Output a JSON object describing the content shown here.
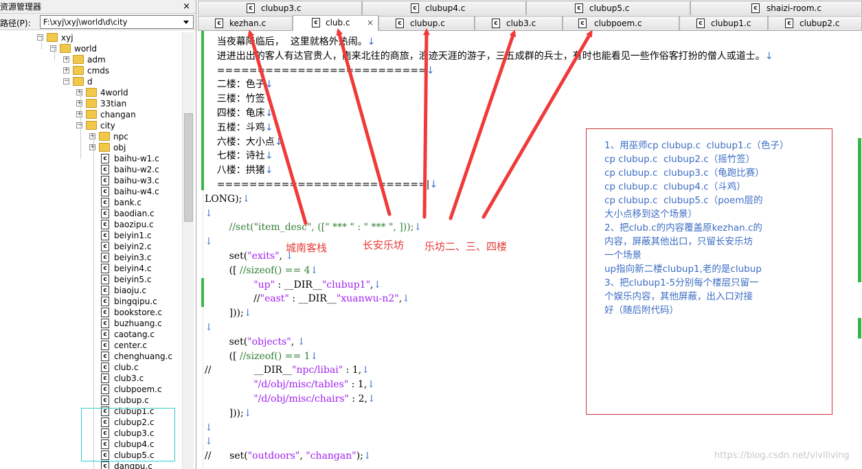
{
  "explorer": {
    "title": "资源管理器",
    "close": "×",
    "path_label": "路径(P):",
    "path_value": "F:\\xyj\\xyj\\world\\d\\city",
    "tree": [
      {
        "text": "xyj",
        "kind": "folder",
        "exp": "⊟"
      },
      {
        "text": "world",
        "kind": "folder",
        "exp": "⊟"
      },
      {
        "text": "adm",
        "kind": "folder",
        "exp": "⊞"
      },
      {
        "text": "cmds",
        "kind": "folder",
        "exp": "⊞"
      },
      {
        "text": "d",
        "kind": "folder",
        "exp": "⊟"
      },
      {
        "text": "4world",
        "kind": "folder",
        "exp": "⊞"
      },
      {
        "text": "33tian",
        "kind": "folder",
        "exp": "⊞"
      },
      {
        "text": "changan",
        "kind": "folder",
        "exp": "⊞"
      },
      {
        "text": "city",
        "kind": "folder",
        "exp": "⊟"
      },
      {
        "text": "npc",
        "kind": "folder",
        "exp": "⊞"
      },
      {
        "text": "obj",
        "kind": "folder",
        "exp": "⊞"
      },
      {
        "text": "baihu-w1.c",
        "kind": "file"
      },
      {
        "text": "baihu-w2.c",
        "kind": "file"
      },
      {
        "text": "baihu-w3.c",
        "kind": "file"
      },
      {
        "text": "baihu-w4.c",
        "kind": "file"
      },
      {
        "text": "bank.c",
        "kind": "file"
      },
      {
        "text": "baodian.c",
        "kind": "file"
      },
      {
        "text": "baozipu.c",
        "kind": "file"
      },
      {
        "text": "beiyin1.c",
        "kind": "file"
      },
      {
        "text": "beiyin2.c",
        "kind": "file"
      },
      {
        "text": "beiyin3.c",
        "kind": "file"
      },
      {
        "text": "beiyin4.c",
        "kind": "file"
      },
      {
        "text": "beiyin5.c",
        "kind": "file"
      },
      {
        "text": "biaoju.c",
        "kind": "file"
      },
      {
        "text": "bingqipu.c",
        "kind": "file"
      },
      {
        "text": "bookstore.c",
        "kind": "file"
      },
      {
        "text": "buzhuang.c",
        "kind": "file"
      },
      {
        "text": "caotang.c",
        "kind": "file"
      },
      {
        "text": "center.c",
        "kind": "file"
      },
      {
        "text": "chenghuang.c",
        "kind": "file"
      },
      {
        "text": "club.c",
        "kind": "file"
      },
      {
        "text": "club3.c",
        "kind": "file"
      },
      {
        "text": "clubpoem.c",
        "kind": "file"
      },
      {
        "text": "clubup.c",
        "kind": "file"
      },
      {
        "text": "clubup1.c",
        "kind": "file"
      },
      {
        "text": "clubup2.c",
        "kind": "file"
      },
      {
        "text": "clubup3.c",
        "kind": "file"
      },
      {
        "text": "clubup4.c",
        "kind": "file"
      },
      {
        "text": "clubup5.c",
        "kind": "file"
      },
      {
        "text": "dangpu.c",
        "kind": "file"
      }
    ]
  },
  "tabs_top": [
    "clubup3.c",
    "clubup4.c",
    "clubup5.c",
    "shaizi-room.c"
  ],
  "tabs_bottom": [
    "kezhan.c",
    "club.c",
    "clubup.c",
    "club3.c",
    "clubpoem.c",
    "clubup1.c",
    "clubup2.c"
  ],
  "tab_close": "×",
  "file_icon_letter": "c",
  "code_lines": [
    "    当夜幕降临后，  这里就格外热闹。↓",
    "    进进出出的客人有达官贵人，南来北往的商旅，浪迹天涯的游子，三五成群的兵士，有时也能看见一些作俗客打扮的僧人或道士。↓",
    "    ==========================↓",
    "    二楼：色子↓",
    "    三楼：竹签↓",
    "    四楼：龟床↓",
    "    五楼：斗鸡↓",
    "    六楼：大小点↓",
    "    七楼：诗社↓",
    "    八楼：拱猪↓",
    "    ==========================|↓",
    "LONG);↓",
    "↓",
    "        //set(\"item_desc\", ([\" *** \" : \" *** \", ]));↓",
    "↓",
    "        set(\"exits\", ↓",
    "        ([ //sizeof() == 4↓",
    "                \"up\" : __DIR__\"clubup1\",↓",
    "                //\"east\" : __DIR__\"xuanwu-n2\",↓",
    "        ]));↓",
    "↓",
    "        set(\"objects\", ↓",
    "        ([ //sizeof() == 1↓",
    "//              __DIR__\"npc/libai\" : 1,↓",
    "                \"/d/obj/misc/tables\" : 1,↓",
    "                \"/d/obj/misc/chairs\" : 2,↓",
    "        ]));↓",
    "↓",
    "↓",
    "//      set(\"outdoors\", \"changan\");↓"
  ],
  "annotations": {
    "labels": [
      "城南客栈",
      "长安乐坊",
      "乐坊二、三、四楼"
    ],
    "note_lines": [
      "1、用巫师cp clubup.c  clubup1.c（色子）",
      "cp clubup.c  clubup2.c（摇竹签）",
      "cp clubup.c  clubup3.c（龟跑比赛）",
      "cp clubup.c  clubup4.c（斗鸡）",
      "cp clubup.c  clubup5.c（poem层的",
      "大小点移到这个场景）",
      "2、把club.c的内容覆盖原kezhan.c的",
      "内容，屏蔽其他出口，只留长安乐坊",
      "一个场景",
      "up指向新二楼clubup1,老的是clubup",
      "3、把clubup1-5分别每个楼层只留一",
      "个娱乐内容，其他屏蔽，出入口对接",
      "好（随后附代码）"
    ],
    "arrow_color": "#f03a3a"
  },
  "watermark": "https://blog.csdn.net/viviliving",
  "colors": {
    "string": "#a020f0",
    "comment": "#2e7d32",
    "note_text": "#3b6cc4",
    "note_border": "#cc3333",
    "change_mark": "#39b54a"
  }
}
